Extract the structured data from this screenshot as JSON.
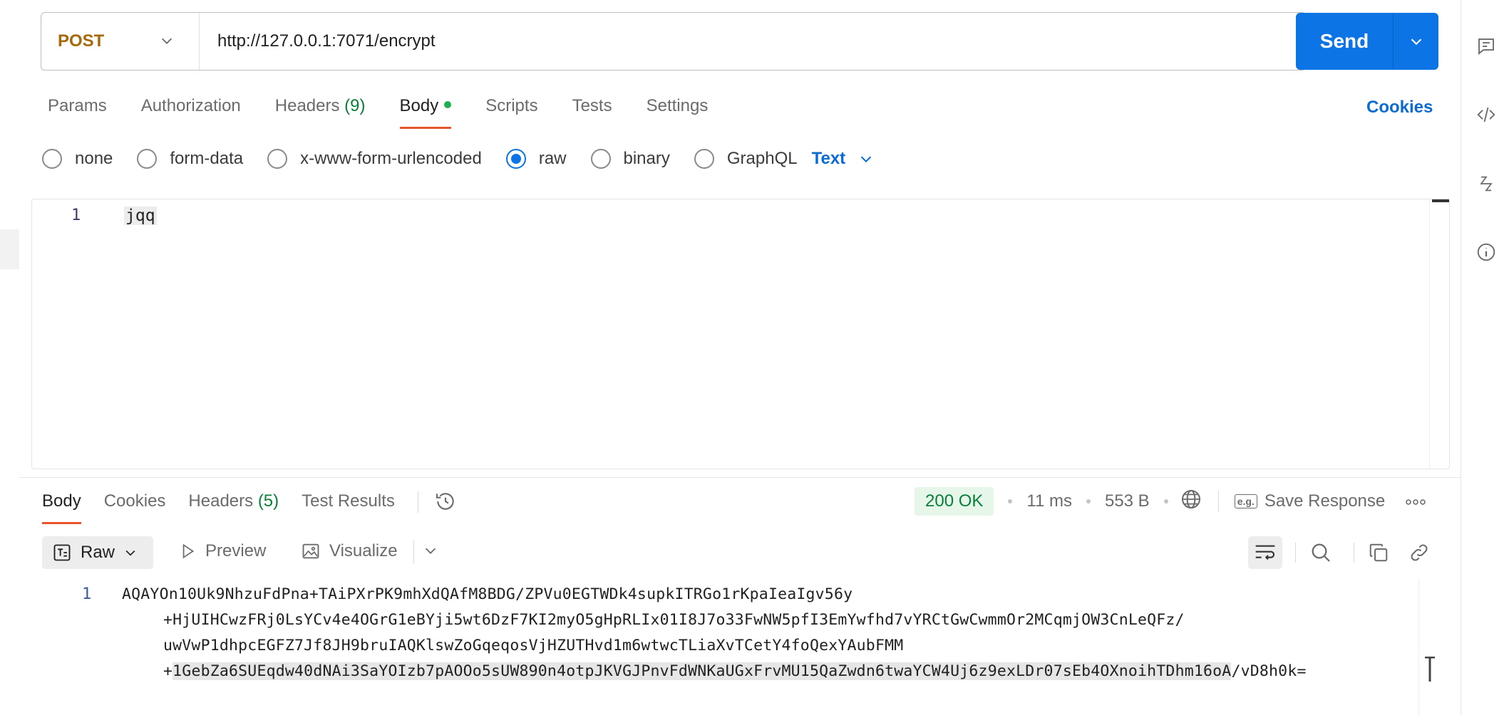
{
  "request": {
    "method": "POST",
    "url": "http://127.0.0.1:7071/encrypt",
    "send_label": "Send"
  },
  "request_tabs": [
    {
      "label": "Params",
      "count": ""
    },
    {
      "label": "Authorization",
      "count": ""
    },
    {
      "label": "Headers",
      "count": "(9)"
    },
    {
      "label": "Body",
      "count": ""
    },
    {
      "label": "Scripts",
      "count": ""
    },
    {
      "label": "Tests",
      "count": ""
    },
    {
      "label": "Settings",
      "count": ""
    }
  ],
  "cookies_link": "Cookies",
  "body_types": [
    {
      "label": "none"
    },
    {
      "label": "form-data"
    },
    {
      "label": "x-www-form-urlencoded"
    },
    {
      "label": "raw"
    },
    {
      "label": "binary"
    },
    {
      "label": "GraphQL"
    }
  ],
  "body_type_selected": "raw",
  "body_format": "Text",
  "editor": {
    "line_number": "1",
    "content": "jqq"
  },
  "response_tabs": [
    {
      "label": "Body",
      "count": ""
    },
    {
      "label": "Cookies",
      "count": ""
    },
    {
      "label": "Headers",
      "count": "(5)"
    },
    {
      "label": "Test Results",
      "count": ""
    }
  ],
  "response_status": {
    "status": "200 OK",
    "time": "11 ms",
    "size": "553 B",
    "save_label": "Save Response",
    "eg_label": "e.g."
  },
  "response_toolbar": {
    "raw_label": "Raw",
    "preview_label": "Preview",
    "visualize_label": "Visualize"
  },
  "response_body": {
    "line_number": "1",
    "line1": "AQAYOn10Uk9NhzuFdPna+TAiPXrPK9mhXdQAfM8BDG/ZPVu0EGTWDk4supkITRGo1rKpaIeaIgv56y",
    "line2": "+HjUIHCwzFRj0LsYCv4e4OGrG1eBYji5wt6DzF7KI2myO5gHpRLIx01I8J7o33FwNW5pfI3EmYwfhd7vYRCtGwCwmmOr2MCqmjOW3CnLeQFz/",
    "line3": "uwVwP1dhpcEGFZ7Jf8JH9bruIAQKlswZoGqeqosVjHZUTHvd1m6wtwcTLiaXvTCetY4foQexYAubFMM",
    "line4_prefix": "+",
    "line4_highlight": "1GebZa6SUEqdw40dNAi3SaYOIzb7pAOOo5sUW890n4otpJKVGJPnvFdWNKaUGxFrvMU15QaZwdn6twaYCW4Uj6z9exLDr07sEb4OXnoihTDhm16oA",
    "line4_suffix": "/vD8h0k="
  },
  "icons": {
    "right_bar": [
      "comment-icon",
      "code-icon",
      "related-icon",
      "info-icon"
    ]
  },
  "colors": {
    "accent": "#0c74e4",
    "method": "#a6690b",
    "status_ok": "#0a7f3a",
    "active_tab": "#e8542b"
  }
}
